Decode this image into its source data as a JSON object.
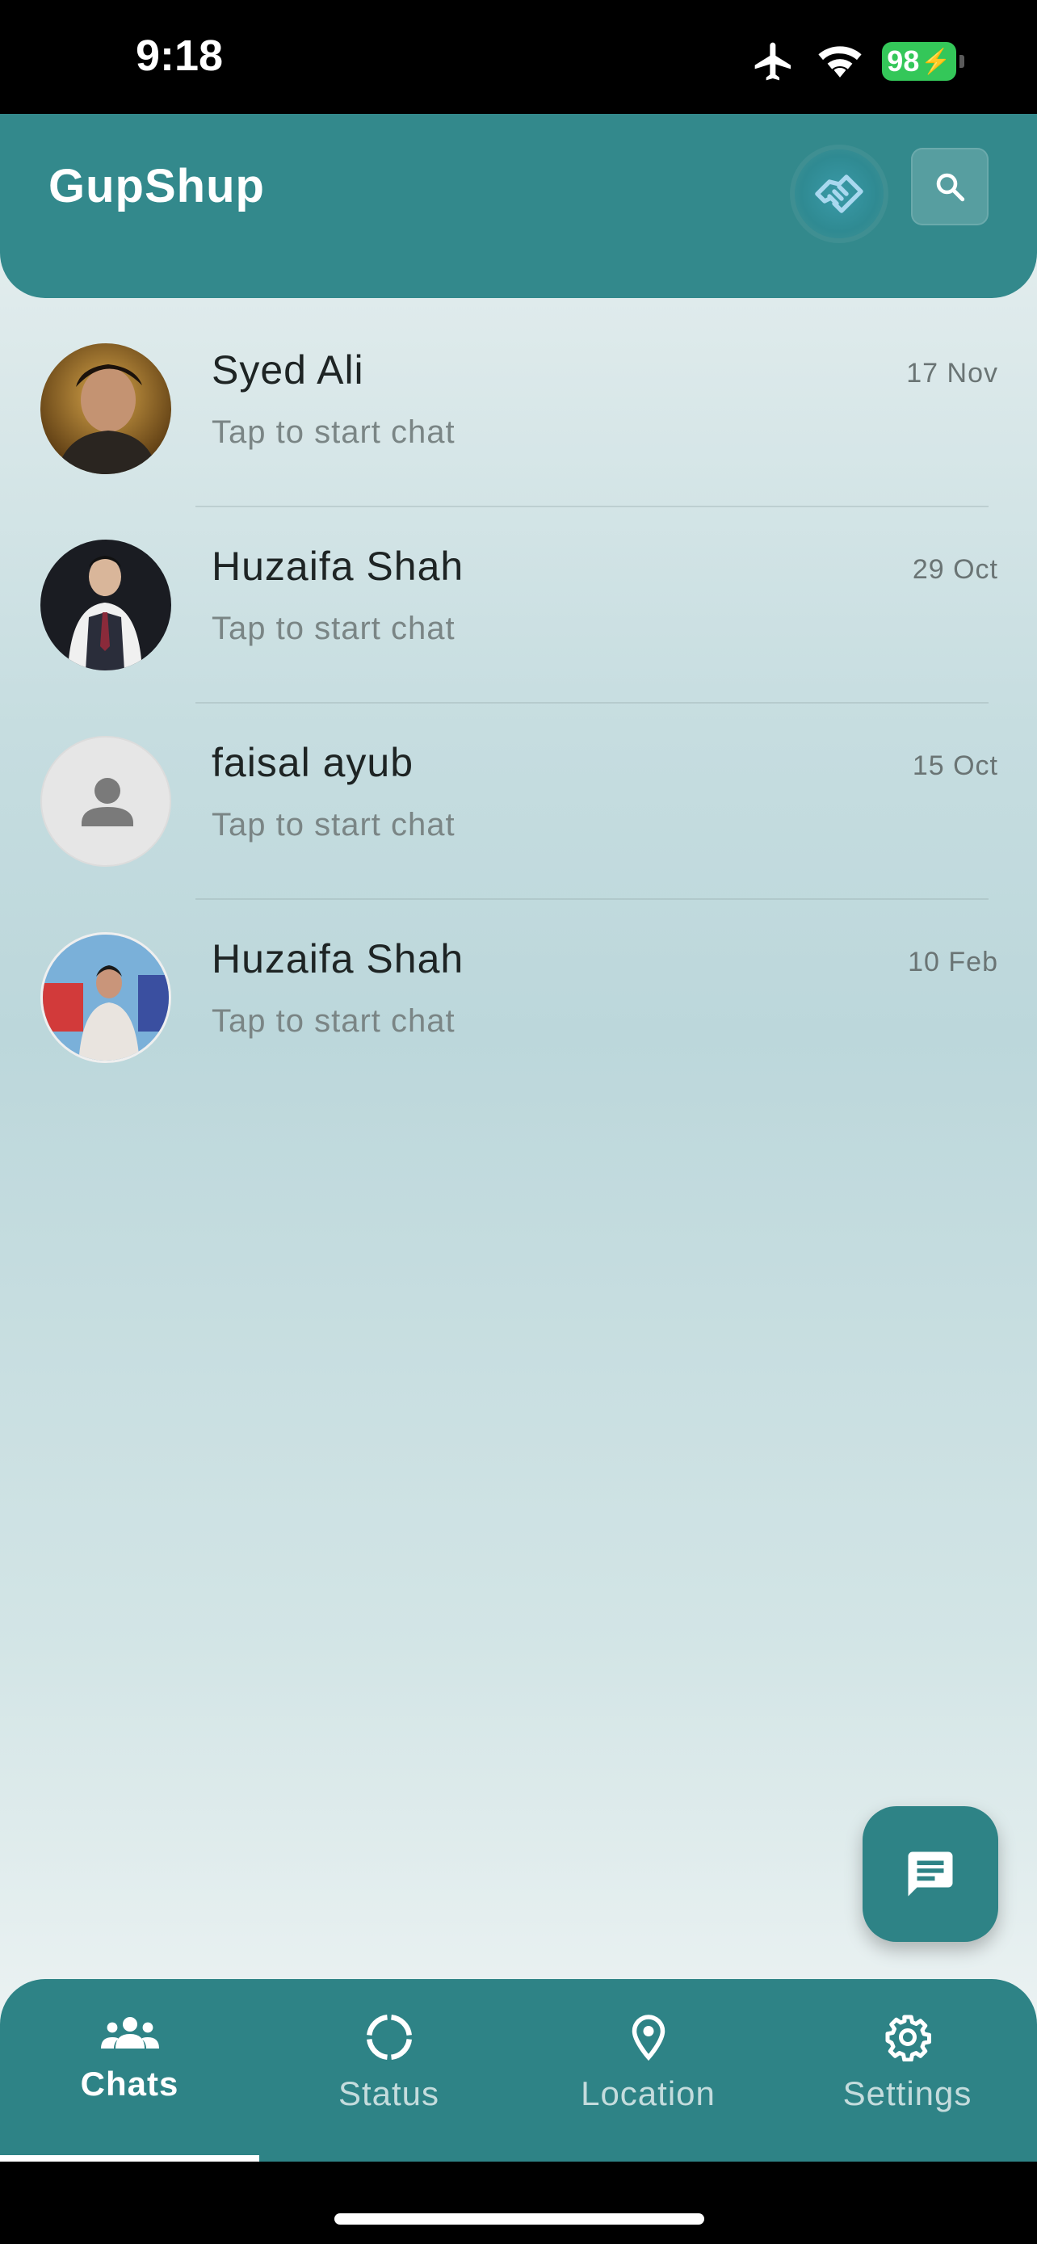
{
  "status_bar": {
    "time": "9:18",
    "battery": "98",
    "icons": [
      "airplane-icon",
      "wifi-icon",
      "battery-charging-icon"
    ],
    "battery_color": "#34c759"
  },
  "header": {
    "title": "GupShup",
    "logo_icon": "handshake-logo-icon",
    "search_icon": "search-icon",
    "color": "#33898c"
  },
  "chats": [
    {
      "name": "Syed Ali",
      "preview": "Tap to start chat",
      "date": "17 Nov",
      "avatar": "photo"
    },
    {
      "name": "Huzaifa Shah",
      "preview": "Tap to start chat",
      "date": "29 Oct",
      "avatar": "photo"
    },
    {
      "name": "faisal ayub",
      "preview": "Tap to start chat",
      "date": "15 Oct",
      "avatar": "placeholder-person-icon"
    },
    {
      "name": "Huzaifa Shah",
      "preview": "Tap to start chat",
      "date": "10 Feb",
      "avatar": "photo"
    }
  ],
  "fab": {
    "icon": "new-message-icon"
  },
  "bottom_nav": {
    "items": [
      {
        "label": "Chats",
        "icon": "group-icon",
        "active": true
      },
      {
        "label": "Status",
        "icon": "status-ring-icon",
        "active": false
      },
      {
        "label": "Location",
        "icon": "location-pin-icon",
        "active": false
      },
      {
        "label": "Settings",
        "icon": "gear-icon",
        "active": false
      }
    ],
    "color": "#2e8386"
  }
}
